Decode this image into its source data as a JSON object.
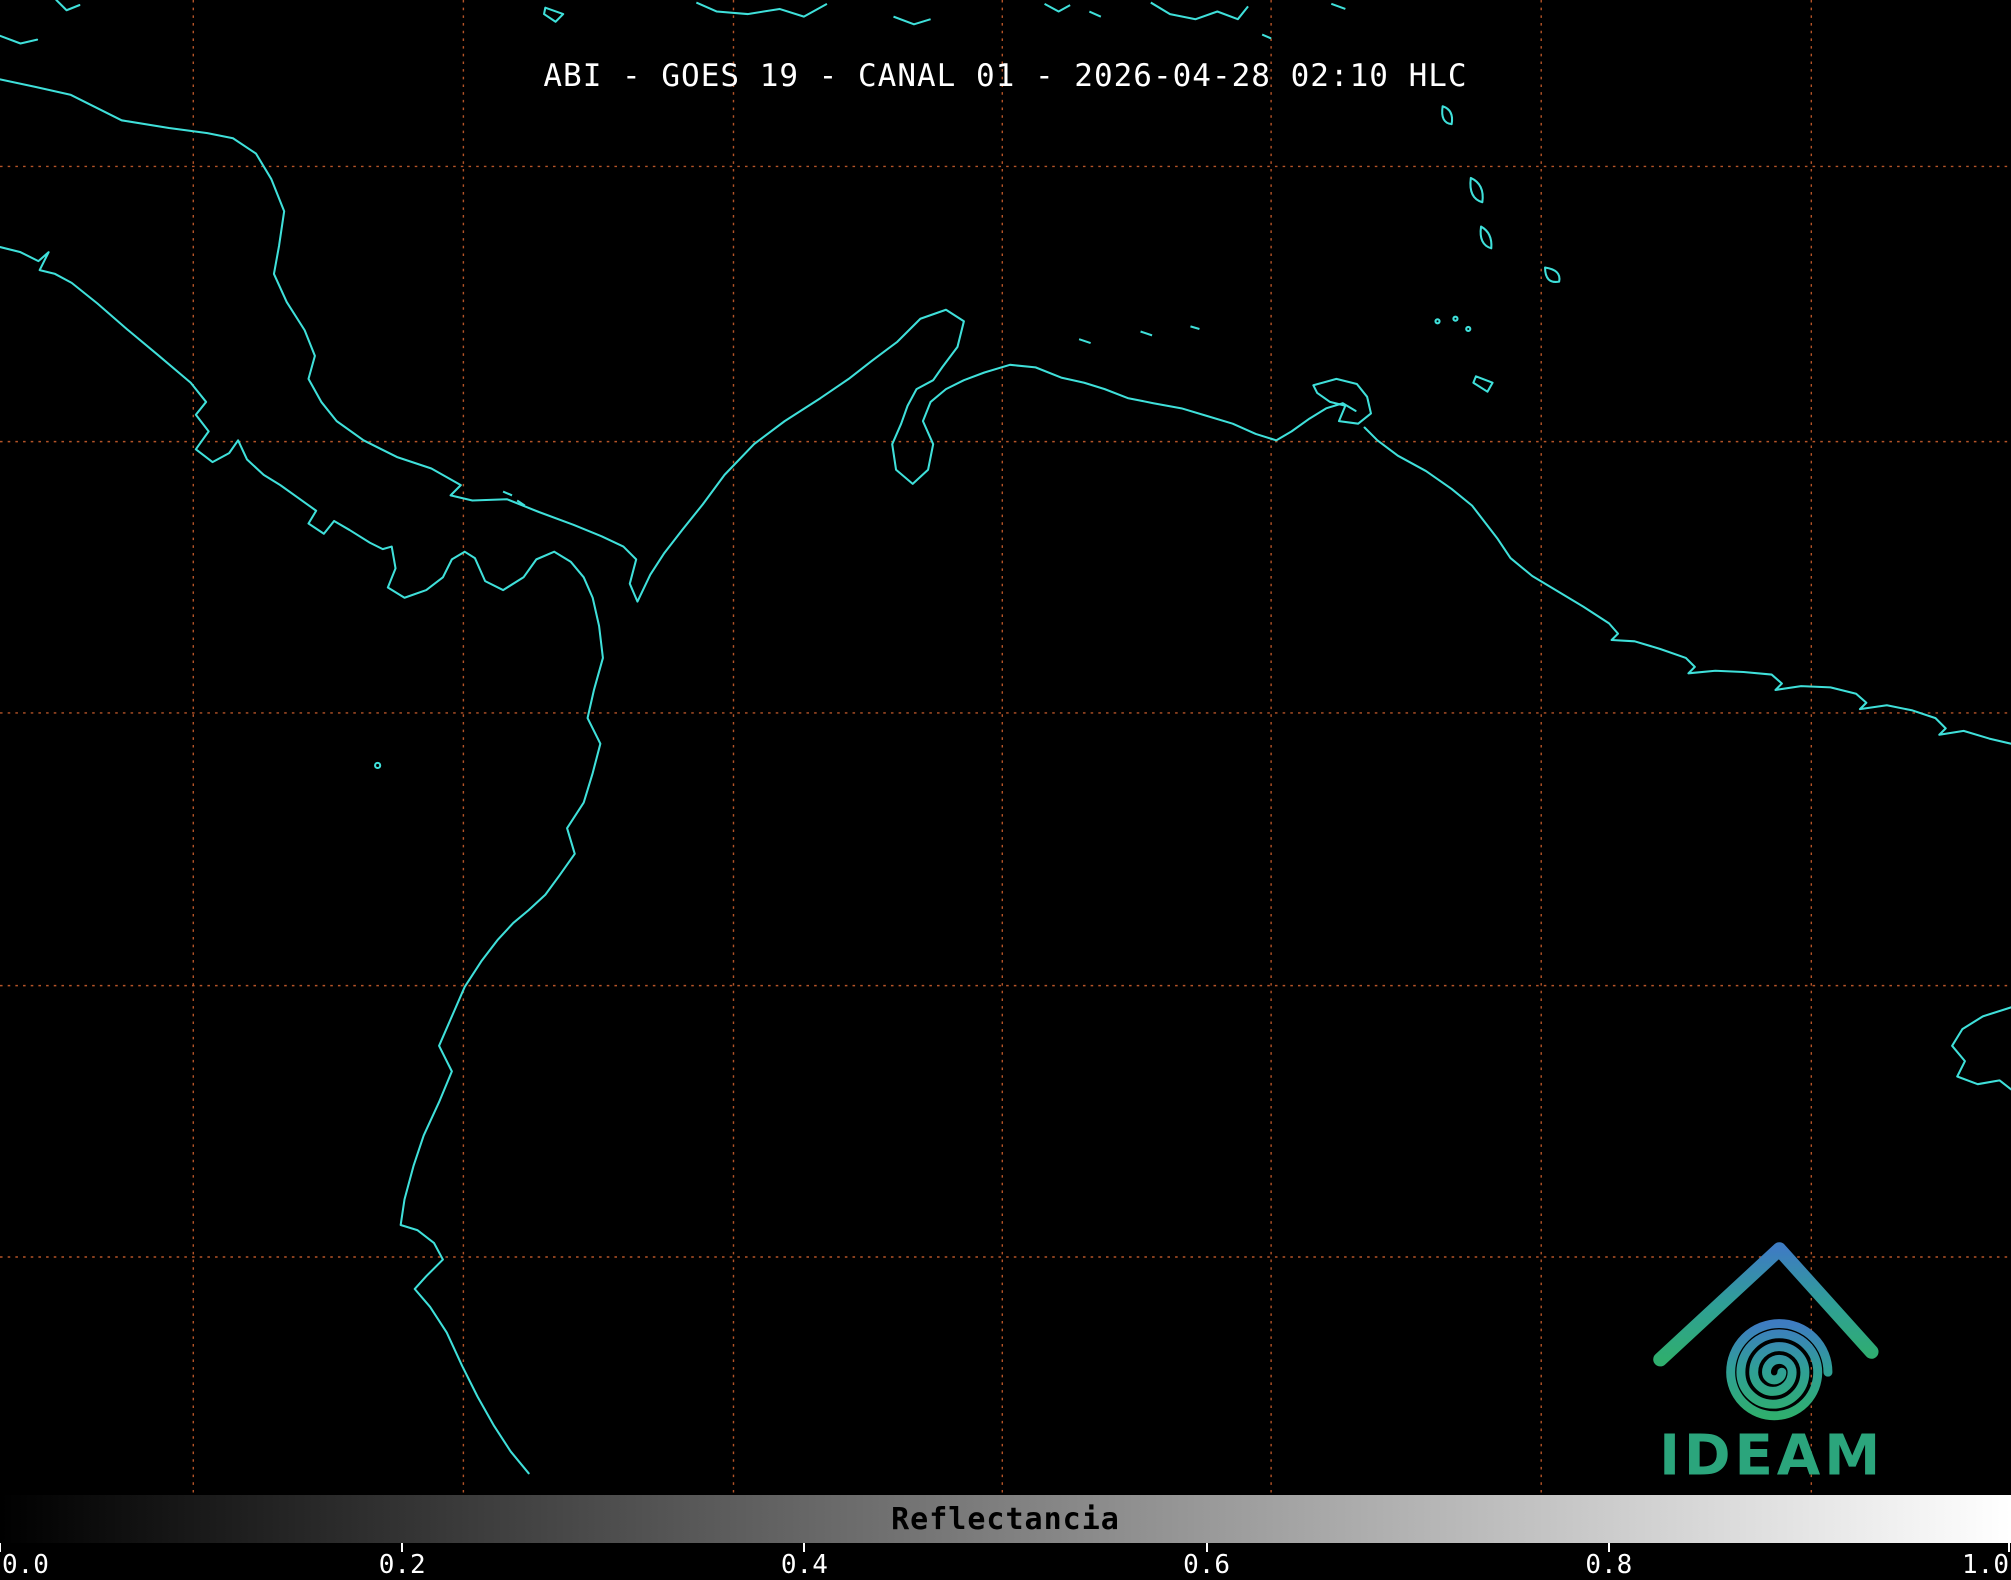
{
  "header": {
    "title": "ABI - GOES 19 - CANAL 01 - 2026-04-28 02:10 HLC",
    "instrument": "ABI",
    "satellite": "GOES 19",
    "channel": "CANAL 01",
    "datetime": "2026-04-28 02:10 HLC"
  },
  "colorbar": {
    "label": "Reflectancia",
    "ticks": [
      "0.0",
      "0.2",
      "0.4",
      "0.6",
      "0.8",
      "1.0"
    ],
    "min": 0.0,
    "max": 1.0,
    "gradient_start": "#000000",
    "gradient_end": "#ffffff"
  },
  "logo": {
    "text": "IDEAM",
    "color": "#2ba57c"
  },
  "map": {
    "background": "#000000",
    "coastline_color": "#3fe0da",
    "grid_color": "#c0582a"
  }
}
